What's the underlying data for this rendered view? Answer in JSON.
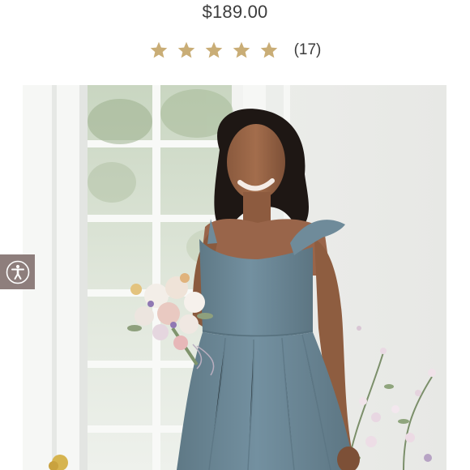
{
  "product": {
    "price": "$189.00",
    "rating": {
      "stars": 5,
      "max_stars": 5,
      "review_count_label": "(17)"
    },
    "image": {
      "alt": "",
      "icon": "product-photo"
    }
  },
  "accessibility": {
    "icon": "accessibility-person-icon"
  },
  "colors": {
    "star": "#c9ad76",
    "text": "#3c3c3c",
    "accessibility_button": "#8e7e7c",
    "dress": "#6b8593"
  }
}
